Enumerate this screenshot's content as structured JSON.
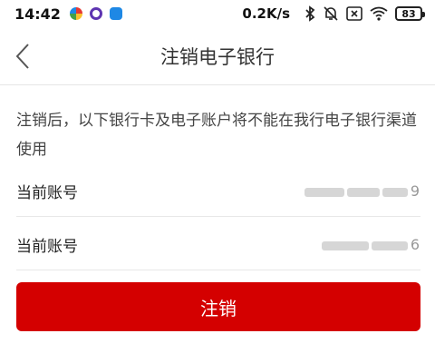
{
  "status_bar": {
    "time": "14:42",
    "net_speed": "0.2K/s",
    "battery": "83"
  },
  "header": {
    "title": "注销电子银行",
    "back_icon": "chevron-left-icon"
  },
  "notice": {
    "text": "注销后，以下银行卡及电子账户将不能在我行电子银行渠道使用"
  },
  "accounts": [
    {
      "label": "当前账号",
      "value_suffix": "9"
    },
    {
      "label": "当前账号",
      "value_suffix": "6"
    }
  ],
  "actions": {
    "cancel_label": "注销"
  },
  "colors": {
    "primary_red": "#d40000",
    "divider": "#e8e8e8"
  }
}
